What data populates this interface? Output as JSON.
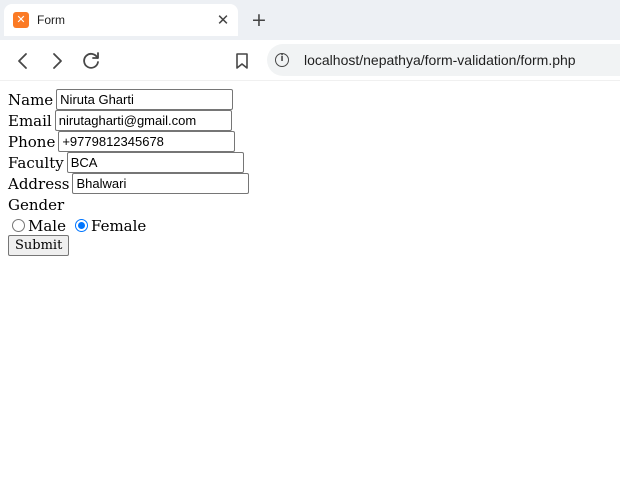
{
  "browser": {
    "tab": {
      "title": "Form",
      "favicon": "xampp-favicon",
      "close_glyph": "✕"
    },
    "new_tab_glyph": "+",
    "url": "localhost/nepathya/form-validation/form.php",
    "icons": [
      "back-icon",
      "forward-icon",
      "reload-icon",
      "bookmark-icon",
      "site-info-icon"
    ]
  },
  "form": {
    "name": {
      "label": "Name",
      "value": "Niruta Gharti"
    },
    "email": {
      "label": "Email",
      "value": "nirutagharti@gmail.com"
    },
    "phone": {
      "label": "Phone",
      "value": "+9779812345678"
    },
    "faculty": {
      "label": "Faculty",
      "value": "BCA"
    },
    "address": {
      "label": "Address",
      "value": "Bhalwari"
    },
    "gender": {
      "label": "Gender",
      "options": [
        {
          "label": "Male",
          "checked": false
        },
        {
          "label": "Female",
          "checked": true
        }
      ]
    },
    "submit_label": "Submit"
  },
  "colors": {
    "radio_checked": "#0075ff",
    "tabstrip_bg": "#edf0f4",
    "favicon": "#fb7a24"
  }
}
